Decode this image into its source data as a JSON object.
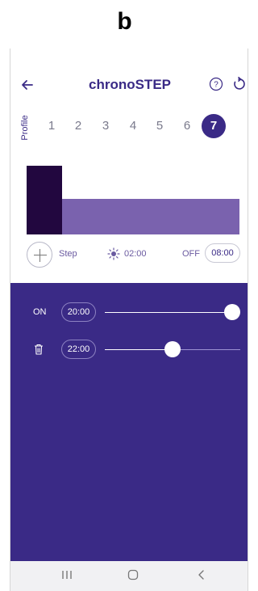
{
  "figure_label": "b",
  "header": {
    "title": "chronoSTEP",
    "icons": [
      "back-arrow-icon",
      "help-circle-icon",
      "reset-icon"
    ]
  },
  "profile": {
    "label": "Profile",
    "options": [
      "1",
      "2",
      "3",
      "4",
      "5",
      "6",
      "7"
    ],
    "selected": "7"
  },
  "step_bar": {
    "add_label": "Step",
    "sun_time": "02:00",
    "off_label": "OFF",
    "off_time": "08:00"
  },
  "schedule": {
    "rows": [
      {
        "label": "ON",
        "time": "20:00",
        "level": 0.94
      },
      {
        "icon": "trash-icon",
        "time": "22:00",
        "level": 0.5
      }
    ]
  },
  "colors": {
    "accent": "#3a2a86",
    "chart_dark": "#22073f",
    "chart_light": "#7a62ae"
  },
  "navigation": [
    "recent-apps-icon",
    "home-icon",
    "back-icon"
  ]
}
